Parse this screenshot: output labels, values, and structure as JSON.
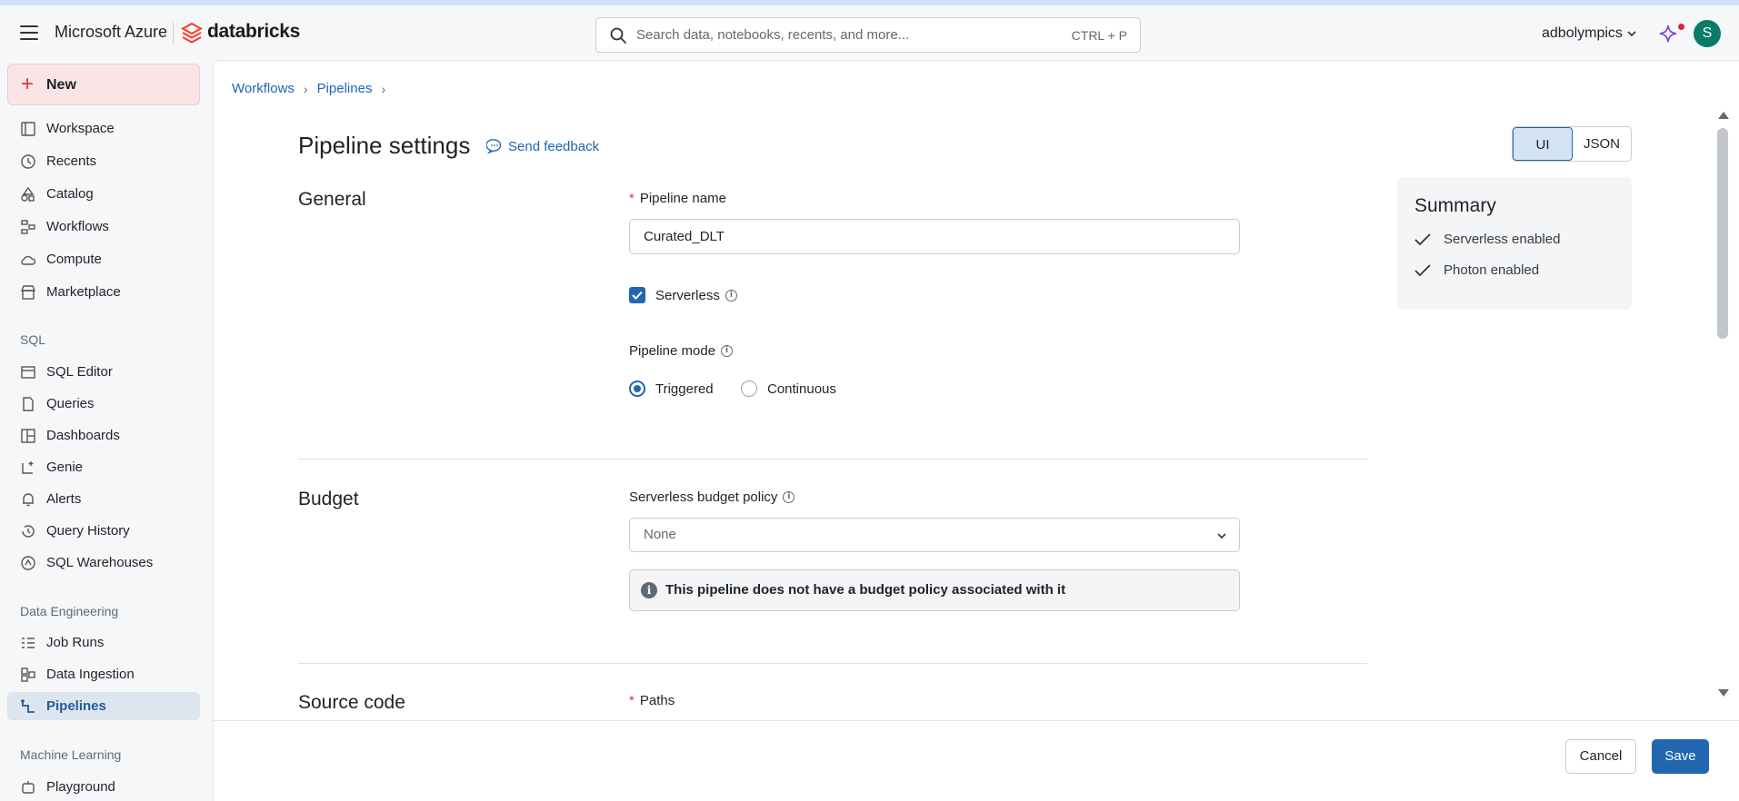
{
  "topbar": {
    "brand_azure": "Microsoft Azure",
    "brand_databricks": "databricks",
    "search_placeholder": "Search data, notebooks, recents, and more...",
    "search_shortcut": "CTRL + P",
    "workspace": "adbolympics",
    "avatar_initial": "S"
  },
  "sidebar": {
    "new_label": "New",
    "items": [
      {
        "label": "Workspace",
        "icon": "workspace-icon"
      },
      {
        "label": "Recents",
        "icon": "clock-icon"
      },
      {
        "label": "Catalog",
        "icon": "catalog-icon"
      },
      {
        "label": "Workflows",
        "icon": "workflows-icon"
      },
      {
        "label": "Compute",
        "icon": "cloud-icon"
      },
      {
        "label": "Marketplace",
        "icon": "store-icon"
      }
    ],
    "sql_section": "SQL",
    "sql_items": [
      {
        "label": "SQL Editor",
        "icon": "sql-editor-icon"
      },
      {
        "label": "Queries",
        "icon": "queries-icon"
      },
      {
        "label": "Dashboards",
        "icon": "dashboards-icon"
      },
      {
        "label": "Genie",
        "icon": "genie-icon"
      },
      {
        "label": "Alerts",
        "icon": "bell-icon"
      },
      {
        "label": "Query History",
        "icon": "history-icon"
      },
      {
        "label": "SQL Warehouses",
        "icon": "warehouse-icon"
      }
    ],
    "de_section": "Data Engineering",
    "de_items": [
      {
        "label": "Job Runs",
        "icon": "job-runs-icon"
      },
      {
        "label": "Data Ingestion",
        "icon": "ingestion-icon"
      },
      {
        "label": "Pipelines",
        "icon": "pipelines-icon",
        "active": true
      }
    ],
    "ml_section": "Machine Learning",
    "ml_items": [
      {
        "label": "Playground",
        "icon": "playground-icon"
      }
    ]
  },
  "breadcrumb": {
    "items": [
      "Workflows",
      "Pipelines"
    ]
  },
  "page": {
    "title": "Pipeline settings",
    "feedback": "Send feedback",
    "view_toggle": {
      "ui": "UI",
      "json": "JSON",
      "selected": "UI"
    }
  },
  "summary": {
    "title": "Summary",
    "items": [
      "Serverless enabled",
      "Photon enabled"
    ]
  },
  "general": {
    "heading": "General",
    "pipeline_name_label": "Pipeline name",
    "pipeline_name_value": "Curated_DLT",
    "serverless_label": "Serverless",
    "serverless_checked": true,
    "mode_label": "Pipeline mode",
    "mode_triggered": "Triggered",
    "mode_continuous": "Continuous",
    "mode_selected": "Triggered"
  },
  "budget": {
    "heading": "Budget",
    "policy_label": "Serverless budget policy",
    "policy_value": "None",
    "alert_text": "This pipeline does not have a budget policy associated with it"
  },
  "source": {
    "heading": "Source code",
    "paths_label": "Paths"
  },
  "footer": {
    "cancel": "Cancel",
    "save": "Save"
  },
  "colors": {
    "accent": "#2266b0",
    "required": "#d33a3f",
    "brand_red": "#ff3621",
    "avatar": "#0b7a66"
  }
}
